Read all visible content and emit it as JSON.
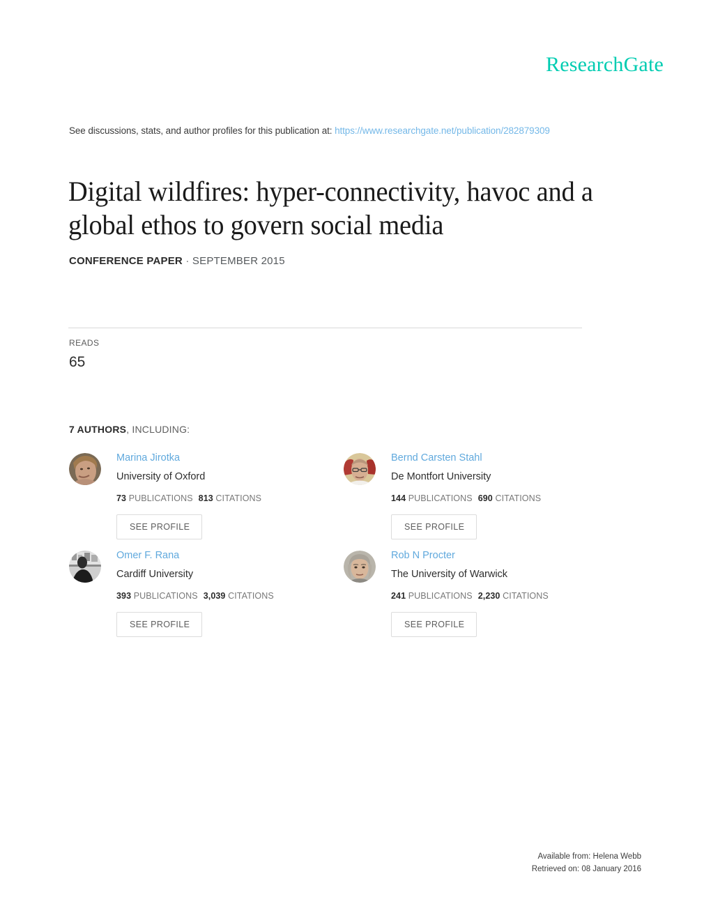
{
  "brand": {
    "name": "ResearchGate",
    "color": "#00ccb1"
  },
  "discussion": {
    "prefix": "See discussions, stats, and author profiles for this publication at:",
    "url": "https://www.researchgate.net/publication/282879309",
    "link_color": "#74b8e8"
  },
  "publication": {
    "title": "Digital wildfires: hyper-connectivity, havoc and a global ethos to govern social media",
    "kind": "CONFERENCE PAPER",
    "separator": "·",
    "date": "SEPTEMBER 2015"
  },
  "stats": {
    "reads_label": "READS",
    "reads_value": "65"
  },
  "authors_section": {
    "count_label": "7 AUTHORS",
    "including_label": ", INCLUDING:",
    "see_profile_label": "SEE PROFILE",
    "publications_label": "PUBLICATIONS",
    "citations_label": "CITATIONS",
    "authors": [
      {
        "name": "Marina Jirotka",
        "institution": "University of Oxford",
        "publications": "73",
        "citations": "813"
      },
      {
        "name": "Bernd Carsten Stahl",
        "institution": "De Montfort University",
        "publications": "144",
        "citations": "690"
      },
      {
        "name": "Omer F. Rana",
        "institution": "Cardiff University",
        "publications": "393",
        "citations": "3,039"
      },
      {
        "name": "Rob N Procter",
        "institution": "The University of Warwick",
        "publications": "241",
        "citations": "2,230"
      }
    ]
  },
  "footer": {
    "available_from": "Available from: Helena Webb",
    "retrieved_on": "Retrieved on: 08 January 2016"
  }
}
